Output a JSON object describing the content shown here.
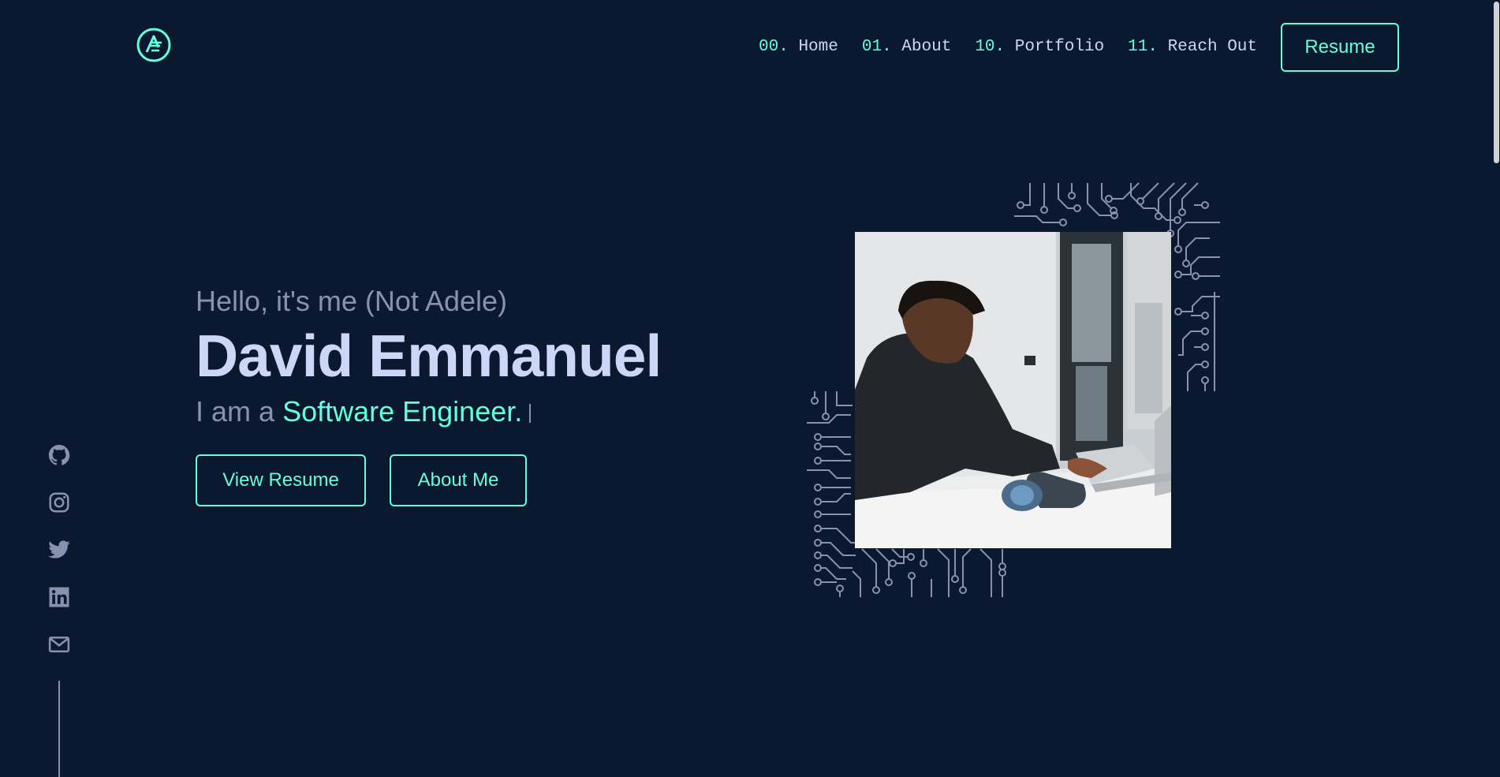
{
  "nav": {
    "items": [
      {
        "num": "00.",
        "label": "Home"
      },
      {
        "num": "01.",
        "label": "About"
      },
      {
        "num": "10.",
        "label": "Portfolio"
      },
      {
        "num": "11.",
        "label": "Reach Out"
      }
    ],
    "resume_label": "Resume"
  },
  "hero": {
    "greeting": "Hello, it's me (Not Adele)",
    "name": "David Emmanuel",
    "role_prefix": "I am a",
    "role_accent": "Software Engineer."
  },
  "cta": {
    "view_resume": "View Resume",
    "about_me": "About Me"
  },
  "social": [
    "github-icon",
    "instagram-icon",
    "twitter-icon",
    "linkedin-icon",
    "mail-icon"
  ],
  "colors": {
    "background": "#0a192f",
    "accent": "#64ffda",
    "text_light": "#ccd6f6",
    "text_muted": "#8892b0"
  }
}
